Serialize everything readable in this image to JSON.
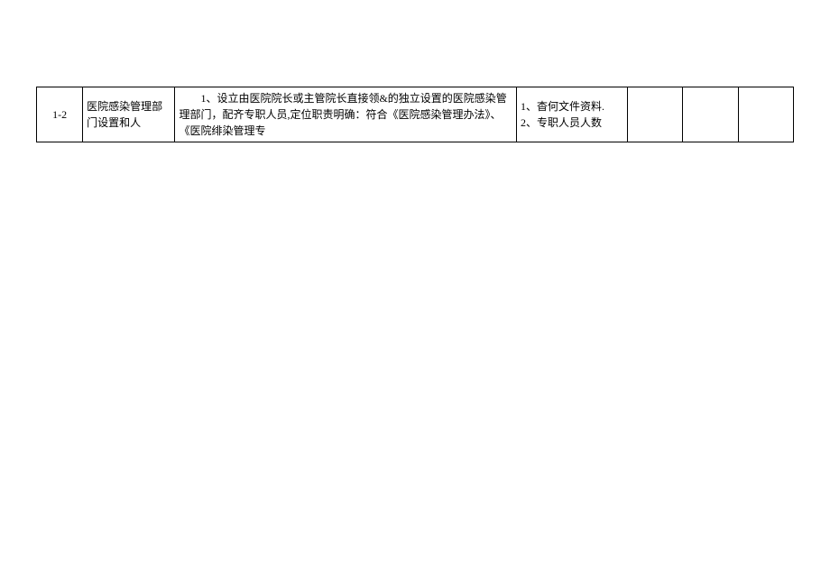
{
  "rows": [
    {
      "id": "1-2",
      "title": "医院感染管理部门设置和人",
      "desc_indent": "　　",
      "desc": "1、设立由医院院长或主管院长直接领&的独立设置的医院感染管理部门，配齐专职人员,定位职责明确：符合《医院感染管理办法》、《医院绯染管理专",
      "check_line1": "1、杳何文件资料.",
      "check_line2": "2、专职人员人数",
      "blank1": "",
      "blank2": "",
      "blank3": ""
    }
  ]
}
